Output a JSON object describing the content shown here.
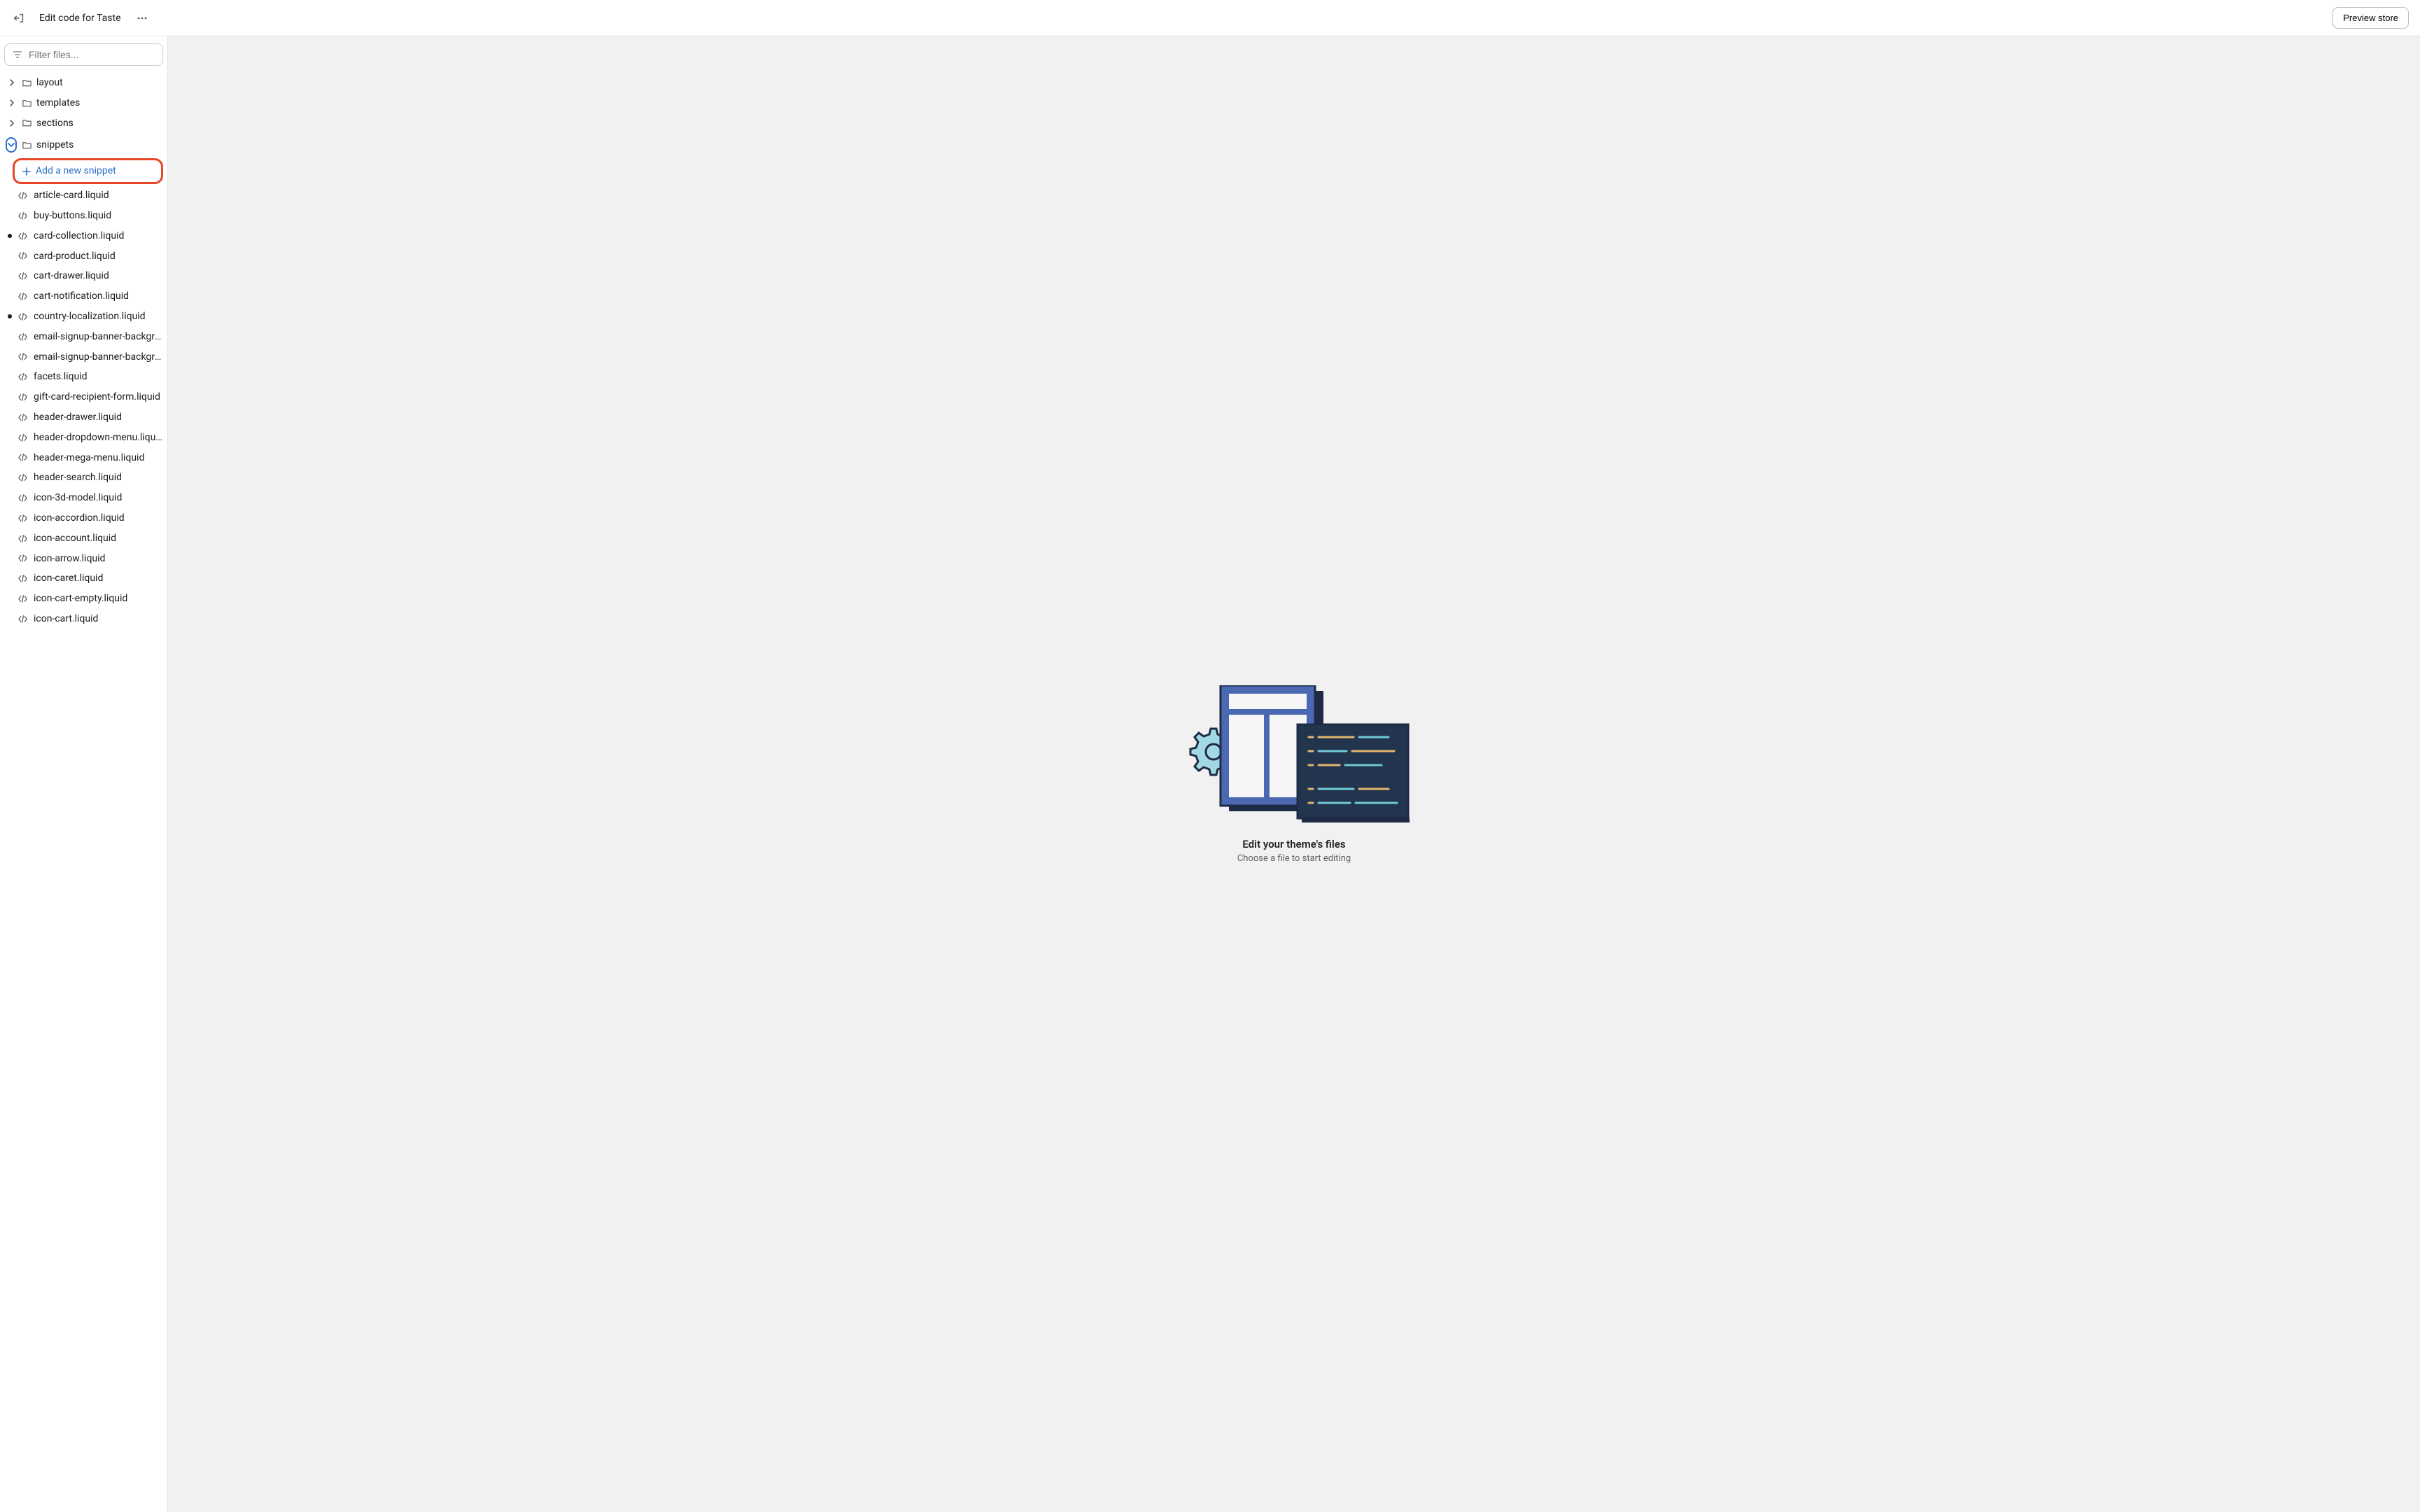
{
  "header": {
    "title": "Edit code for Taste",
    "preview_label": "Preview store"
  },
  "sidebar": {
    "filter_placeholder": "Filter files...",
    "folders": [
      {
        "name": "layout",
        "expanded": false
      },
      {
        "name": "templates",
        "expanded": false
      },
      {
        "name": "sections",
        "expanded": false
      },
      {
        "name": "snippets",
        "expanded": true
      }
    ],
    "add_snippet_label": "Add a new snippet",
    "files": [
      {
        "name": "article-card.liquid",
        "modified": false
      },
      {
        "name": "buy-buttons.liquid",
        "modified": false
      },
      {
        "name": "card-collection.liquid",
        "modified": true
      },
      {
        "name": "card-product.liquid",
        "modified": false
      },
      {
        "name": "cart-drawer.liquid",
        "modified": false
      },
      {
        "name": "cart-notification.liquid",
        "modified": false
      },
      {
        "name": "country-localization.liquid",
        "modified": true
      },
      {
        "name": "email-signup-banner-background-m...",
        "modified": false
      },
      {
        "name": "email-signup-banner-background.liq...",
        "modified": false
      },
      {
        "name": "facets.liquid",
        "modified": false
      },
      {
        "name": "gift-card-recipient-form.liquid",
        "modified": false
      },
      {
        "name": "header-drawer.liquid",
        "modified": false
      },
      {
        "name": "header-dropdown-menu.liquid",
        "modified": false
      },
      {
        "name": "header-mega-menu.liquid",
        "modified": false
      },
      {
        "name": "header-search.liquid",
        "modified": false
      },
      {
        "name": "icon-3d-model.liquid",
        "modified": false
      },
      {
        "name": "icon-accordion.liquid",
        "modified": false
      },
      {
        "name": "icon-account.liquid",
        "modified": false
      },
      {
        "name": "icon-arrow.liquid",
        "modified": false
      },
      {
        "name": "icon-caret.liquid",
        "modified": false
      },
      {
        "name": "icon-cart-empty.liquid",
        "modified": false
      },
      {
        "name": "icon-cart.liquid",
        "modified": false
      }
    ]
  },
  "empty_state": {
    "title": "Edit your theme's files",
    "subtitle": "Choose a file to start editing"
  }
}
